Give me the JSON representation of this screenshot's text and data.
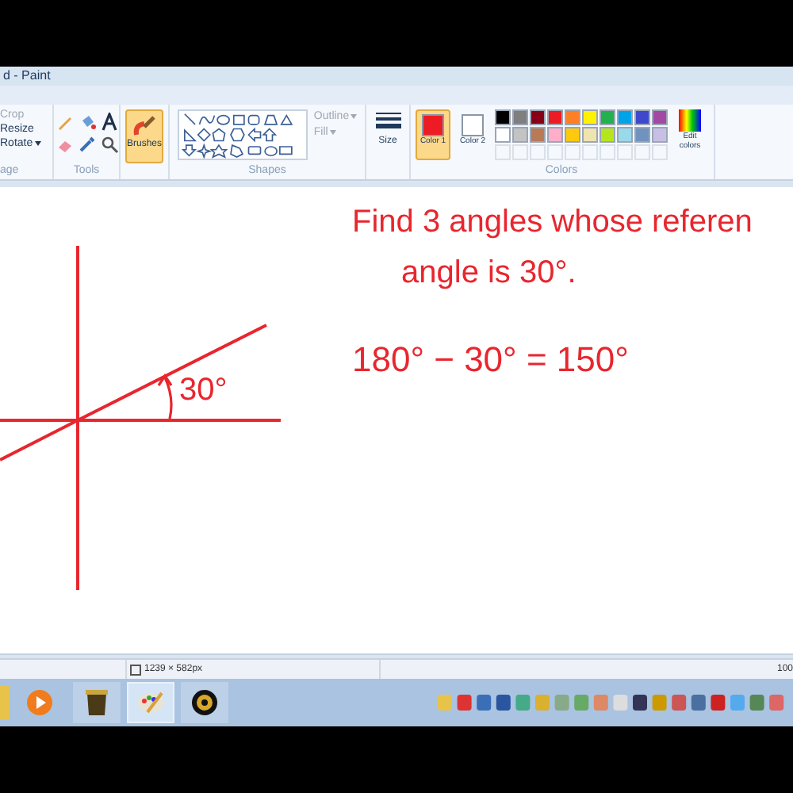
{
  "window": {
    "title": "d - Paint"
  },
  "ribbon": {
    "image": {
      "label": "age",
      "items": [
        {
          "label": "Crop",
          "disabled": true
        },
        {
          "label": "Resize",
          "disabled": false
        },
        {
          "label": "Rotate",
          "disabled": false,
          "has_menu": true
        }
      ]
    },
    "tools": {
      "label": "Tools"
    },
    "brushes": {
      "label": "Brushes",
      "selected": true
    },
    "shapes": {
      "label": "Shapes",
      "outline": {
        "label": "Outline",
        "disabled": true
      },
      "fill": {
        "label": "Fill",
        "disabled": true
      }
    },
    "size": {
      "label": "Size"
    },
    "colors": {
      "label": "Colors",
      "color1": {
        "label": "Color 1",
        "color": "#ed1c24",
        "selected": true
      },
      "color2": {
        "label": "Color 2",
        "color": "#ffffff",
        "selected": false
      },
      "palette": [
        {
          "color": "#000000"
        },
        {
          "color": "#7f7f7f"
        },
        {
          "color": "#880015"
        },
        {
          "color": "#ed1c24"
        },
        {
          "color": "#ff7f27"
        },
        {
          "color": "#fff200"
        },
        {
          "color": "#22b14c"
        },
        {
          "color": "#00a2e8"
        },
        {
          "color": "#3f48cc"
        },
        {
          "color": "#a349a4"
        },
        {
          "color": "#ffffff"
        },
        {
          "color": "#c3c3c3"
        },
        {
          "color": "#b97a57"
        },
        {
          "color": "#ffaec9"
        },
        {
          "color": "#ffc90e"
        },
        {
          "color": "#efe4b0"
        },
        {
          "color": "#b5e61d"
        },
        {
          "color": "#99d9ea"
        },
        {
          "color": "#7092be"
        },
        {
          "color": "#c8bfe7"
        },
        {
          "kind": "empty"
        },
        {
          "kind": "empty"
        },
        {
          "kind": "empty"
        },
        {
          "kind": "empty"
        },
        {
          "kind": "empty"
        },
        {
          "kind": "empty"
        },
        {
          "kind": "empty"
        },
        {
          "kind": "empty"
        },
        {
          "kind": "empty"
        },
        {
          "kind": "empty"
        }
      ],
      "edit": {
        "label": "Edit colors"
      }
    }
  },
  "canvas": {
    "notes": [
      {
        "text": "Find 3 angles whose referen"
      },
      {
        "text": "angle is 30°."
      },
      {
        "text": "180° − 30° = 150°"
      }
    ],
    "angle_label": "30°"
  },
  "status_bar": {
    "dimensions": "1239 × 582px",
    "zoom": "100"
  }
}
